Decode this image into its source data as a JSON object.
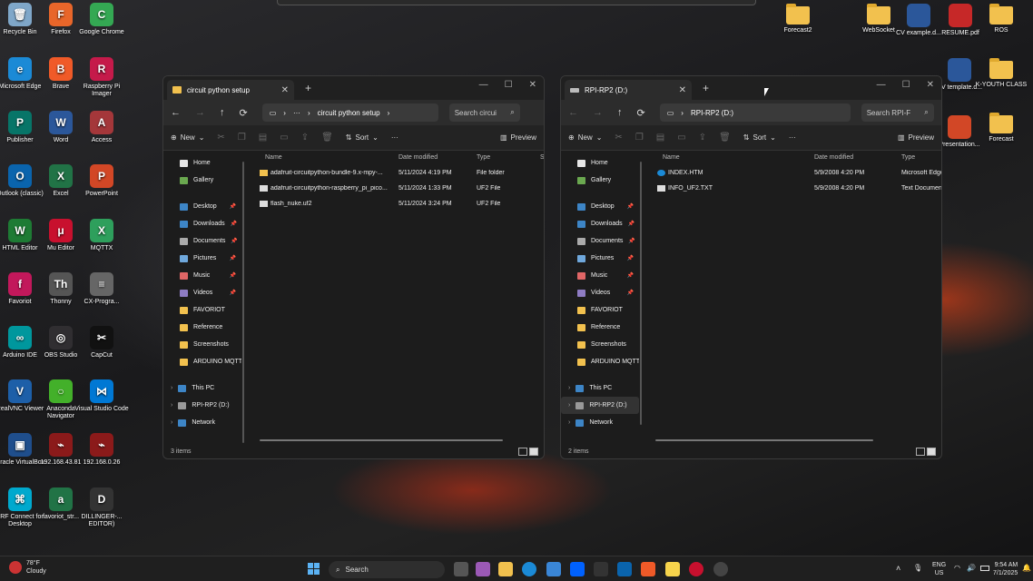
{
  "desktop": {
    "icons_left": [
      {
        "label": "Recycle Bin",
        "color": "#7fa7c9",
        "glyph": "🗑"
      },
      {
        "label": "Firefox",
        "color": "#e8662a",
        "glyph": "F"
      },
      {
        "label": "Google Chrome",
        "color": "#34a853",
        "glyph": "C"
      },
      {
        "label": "Microsoft Edge",
        "color": "#1b8ad6",
        "glyph": "e"
      },
      {
        "label": "Brave",
        "color": "#f05a28",
        "glyph": "B"
      },
      {
        "label": "Raspberry Pi Imager",
        "color": "#c51a4a",
        "glyph": "R"
      },
      {
        "label": "Publisher",
        "color": "#077568",
        "glyph": "P"
      },
      {
        "label": "Word",
        "color": "#2b579a",
        "glyph": "W"
      },
      {
        "label": "Access",
        "color": "#a4373a",
        "glyph": "A"
      },
      {
        "label": "Outlook (classic)",
        "color": "#0a64ad",
        "glyph": "O"
      },
      {
        "label": "Excel",
        "color": "#217346",
        "glyph": "X"
      },
      {
        "label": "PowerPoint",
        "color": "#d24726",
        "glyph": "P"
      },
      {
        "label": "HTML Editor",
        "color": "#1e7b34",
        "glyph": "W"
      },
      {
        "label": "Mu Editor",
        "color": "#c8102e",
        "glyph": "μ"
      },
      {
        "label": "MQTTX",
        "color": "#2e9f5c",
        "glyph": "X"
      },
      {
        "label": "Favoriot",
        "color": "#c2185b",
        "glyph": "f"
      },
      {
        "label": "Thonny",
        "color": "#555555",
        "glyph": "Th"
      },
      {
        "label": "CX-Progra...",
        "color": "#666666",
        "glyph": "≡"
      },
      {
        "label": "Arduino IDE",
        "color": "#00979d",
        "glyph": "∞"
      },
      {
        "label": "OBS Studio",
        "color": "#302e31",
        "glyph": "◎"
      },
      {
        "label": "CapCut",
        "color": "#111111",
        "glyph": "✂"
      },
      {
        "label": "RealVNC Viewer",
        "color": "#1d5fa8",
        "glyph": "V"
      },
      {
        "label": "Anaconda Navigator",
        "color": "#43b02a",
        "glyph": "○"
      },
      {
        "label": "Visual Studio Code",
        "color": "#0078d4",
        "glyph": "⋈"
      },
      {
        "label": "Oracle VirtualBox",
        "color": "#1f4e8c",
        "glyph": "▣"
      },
      {
        "label": "192.168.43.81",
        "color": "#8b1a1a",
        "glyph": "⌁"
      },
      {
        "label": "192.168.0.26",
        "color": "#8b1a1a",
        "glyph": "⌁"
      },
      {
        "label": "nRF Connect for Desktop",
        "color": "#00a9ce",
        "glyph": "⌘"
      },
      {
        "label": "favoriot_str...",
        "color": "#217346",
        "glyph": "a"
      },
      {
        "label": "DILLINGER-... EDITOR)",
        "color": "#333333",
        "glyph": "D"
      }
    ],
    "icons_right": [
      {
        "label": "Forecast2",
        "type": "folder"
      },
      {
        "label": "WebSocket",
        "type": "folder"
      },
      {
        "label": "CV example.d...",
        "type": "word"
      },
      {
        "label": "RESUME.pdf",
        "type": "pdf"
      },
      {
        "label": "ROS",
        "type": "folder"
      },
      {
        "label": "CV template.d...",
        "type": "word"
      },
      {
        "label": "K-YOUTH CLASS",
        "type": "folder"
      },
      {
        "label": "Presentation...",
        "type": "ppt"
      },
      {
        "label": "Forecast",
        "type": "folder"
      }
    ]
  },
  "window1": {
    "tab_title": "circuit python setup",
    "address": "circuit python setup",
    "search_placeholder": "Search circui",
    "cmd": {
      "new": "New",
      "sort": "Sort",
      "preview": "Preview"
    },
    "sidebar": [
      "Home",
      "Gallery",
      "Desktop",
      "Downloads",
      "Documents",
      "Pictures",
      "Music",
      "Videos",
      "FAVORIOT",
      "Reference",
      "Screenshots",
      "ARDUINO MQTT",
      "This PC",
      "RPI-RP2 (D:)",
      "Network"
    ],
    "columns": {
      "name": "Name",
      "date": "Date modified",
      "type": "Type",
      "size": "Si"
    },
    "files": [
      {
        "name": "adafruit-circuitpython-bundle-9.x-mpy-...",
        "date": "5/11/2024 4:19 PM",
        "type": "File folder",
        "kind": "folder"
      },
      {
        "name": "adafruit-circuitpython-raspberry_pi_pico...",
        "date": "5/11/2024 1:33 PM",
        "type": "UF2 File",
        "kind": "file"
      },
      {
        "name": "flash_nuke.uf2",
        "date": "5/11/2024 3:24 PM",
        "type": "UF2 File",
        "kind": "file"
      }
    ],
    "status": "3 items"
  },
  "window2": {
    "tab_title": "RPI-RP2 (D:)",
    "address": "RPI-RP2 (D:)",
    "search_placeholder": "Search RPI-F",
    "cmd": {
      "new": "New",
      "sort": "Sort",
      "preview": "Preview"
    },
    "sidebar": [
      "Home",
      "Gallery",
      "Desktop",
      "Downloads",
      "Documents",
      "Pictures",
      "Music",
      "Videos",
      "FAVORIOT",
      "Reference",
      "Screenshots",
      "ARDUINO MQTT",
      "This PC",
      "RPI-RP2 (D:)",
      "Network"
    ],
    "columns": {
      "name": "Name",
      "date": "Date modified",
      "type": "Type"
    },
    "files": [
      {
        "name": "INDEX.HTM",
        "date": "5/9/2008 4:20 PM",
        "type": "Microsoft Edge",
        "kind": "edge"
      },
      {
        "name": "INFO_UF2.TXT",
        "date": "5/9/2008 4:20 PM",
        "type": "Text Documen",
        "kind": "file"
      }
    ],
    "status": "2 items"
  },
  "taskbar": {
    "weather_temp": "78°F",
    "weather_text": "Cloudy",
    "search_label": "Search",
    "lang": "ENG",
    "region": "US",
    "time": "9:54 AM",
    "date": "7/1/2025"
  }
}
